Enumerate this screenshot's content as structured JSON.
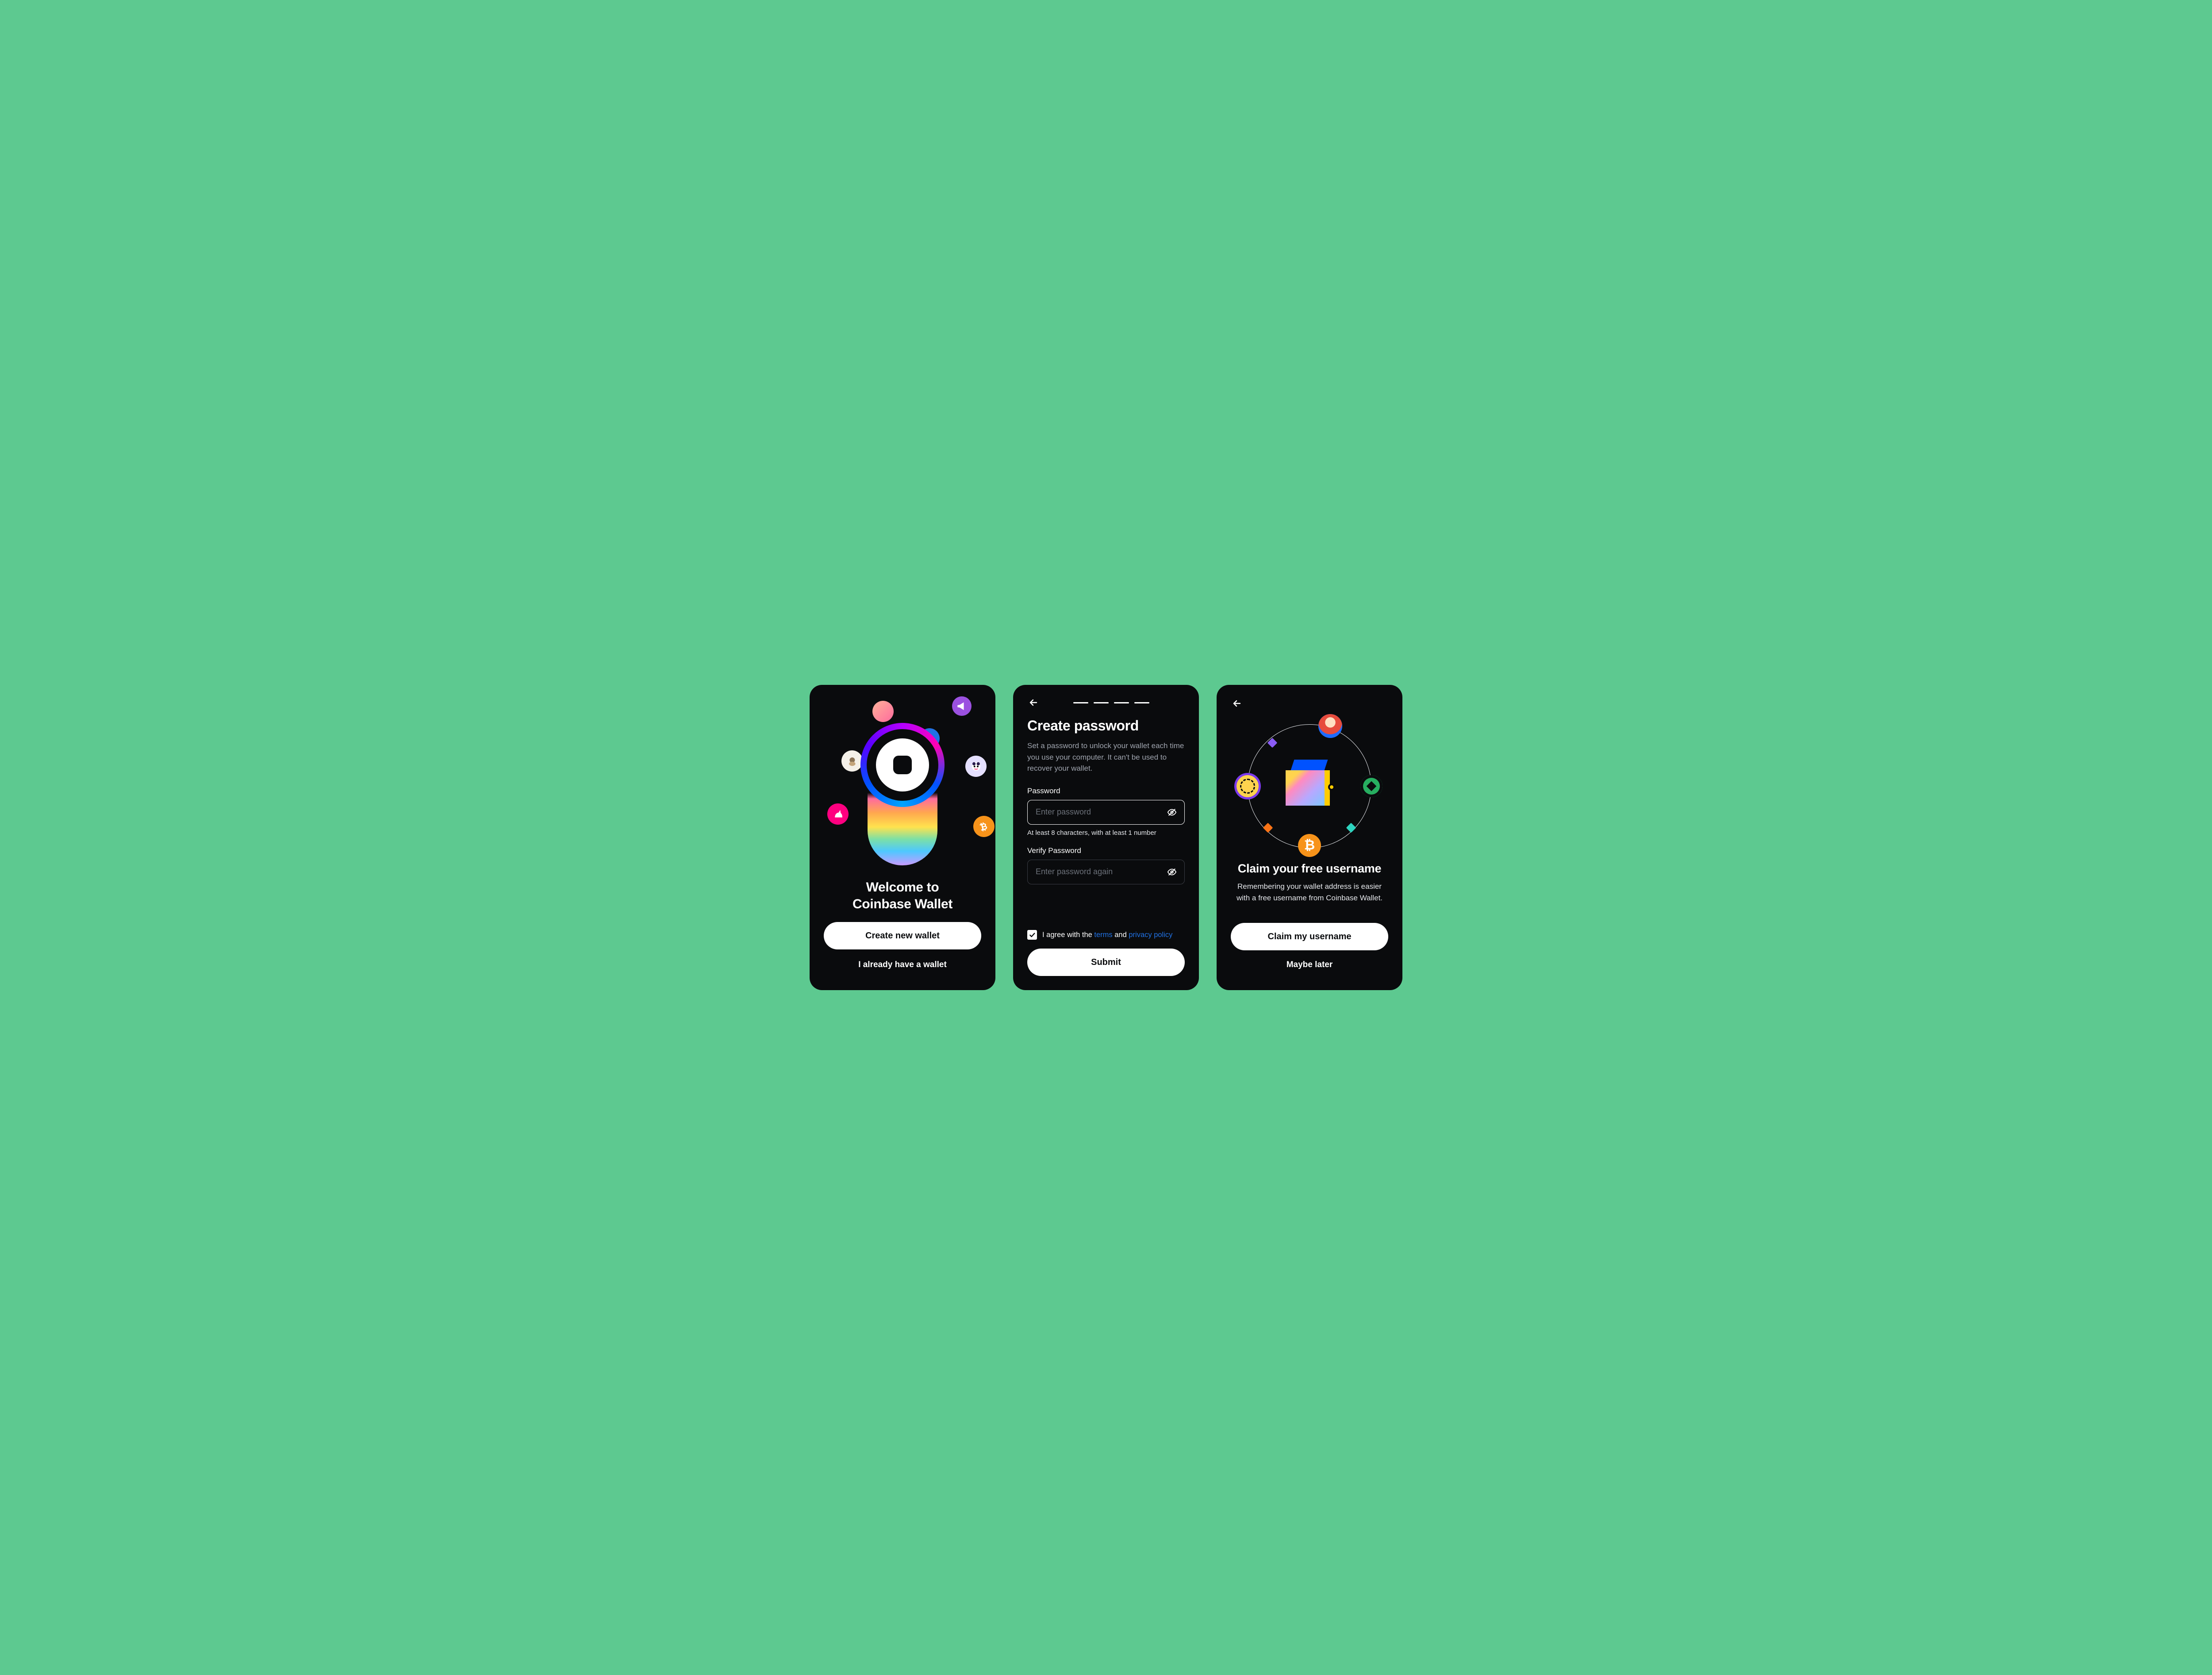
{
  "colors": {
    "background": "#5DC990",
    "surface": "#0A0B0D",
    "primary_button_bg": "#FFFFFF",
    "primary_button_fg": "#0A0B0D",
    "link": "#2172E5",
    "muted_text": "#9FA4AE"
  },
  "screen1": {
    "title_line1": "Welcome to",
    "title_line2": "Coinbase Wallet",
    "create_label": "Create new wallet",
    "existing_label": "I already have a wallet",
    "floating_icons": [
      "avatar-woman",
      "megaphone",
      "eth-sail",
      "ape-nft",
      "panda-nft",
      "unicorn",
      "bitcoin"
    ]
  },
  "screen2": {
    "progress_total_steps": 4,
    "title": "Create password",
    "description": "Set a password to unlock your wallet each time you use your computer. It can't be used to recover your wallet.",
    "password": {
      "label": "Password",
      "placeholder": "Enter password",
      "hint": "At least 8 characters, with at least 1 number"
    },
    "verify": {
      "label": "Verify Password",
      "placeholder": "Enter password again"
    },
    "agree": {
      "checked": true,
      "prefix": "I agree with the ",
      "terms_label": "terms",
      "connector": " and ",
      "privacy_label": "privacy policy"
    },
    "submit_label": "Submit"
  },
  "screen3": {
    "title": "Claim your free username",
    "description": "Remembering your wallet address is easier with a free username from Coinbase Wallet.",
    "claim_label": "Claim my username",
    "later_label": "Maybe later",
    "orbit_icons": [
      "avatar",
      "plate-green",
      "diamond-teal",
      "bitcoin",
      "diamond-orange",
      "coin-token",
      "diamond-purple"
    ]
  }
}
